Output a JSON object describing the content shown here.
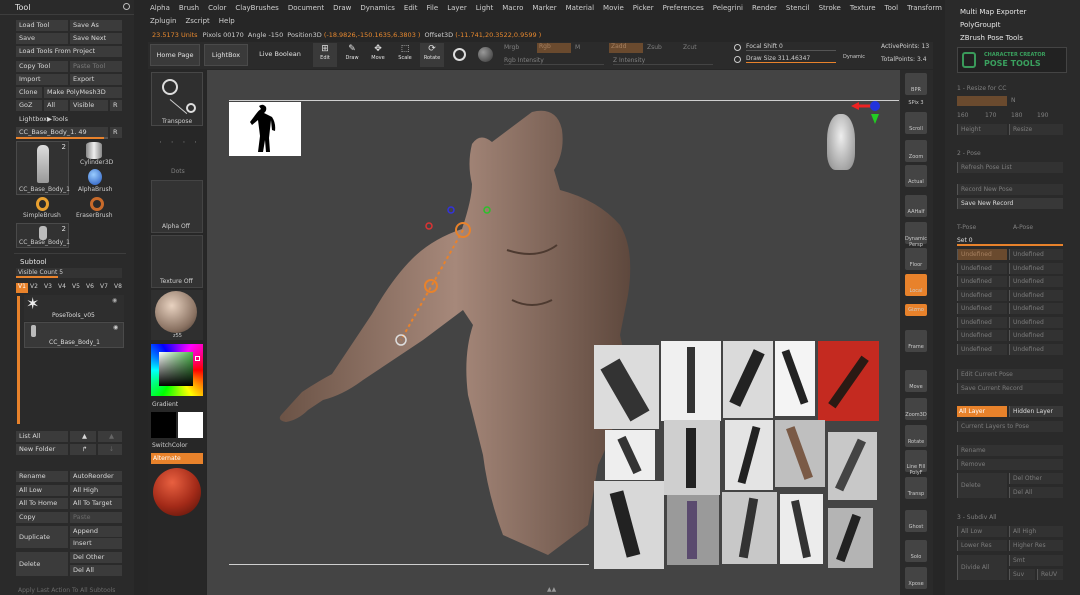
{
  "tool_panel": {
    "title": "Tool",
    "buttons": [
      {
        "label": "Load Tool"
      },
      {
        "label": "Save As"
      },
      {
        "label": "Save"
      },
      {
        "label": "Save Next"
      },
      {
        "label": "Load Tools From Project"
      },
      {
        "label": "Copy Tool"
      },
      {
        "label": "Paste Tool"
      },
      {
        "label": "Import"
      },
      {
        "label": "Export"
      },
      {
        "label": "Clone"
      },
      {
        "label": "Make PolyMesh3D"
      },
      {
        "label": "GoZ"
      },
      {
        "label": "All"
      },
      {
        "label": "Visible"
      },
      {
        "label": "R"
      },
      {
        "label": "Lightbox▶Tools"
      }
    ],
    "current_tool": "CC_Base_Body_1. 49",
    "current_tool_r": "R",
    "thumbs": [
      {
        "label": "CC_Base_Body_1",
        "count": "2"
      },
      {
        "label": "Cylinder3D",
        "count": ""
      },
      {
        "label": "AlphaBrush",
        "count": ""
      },
      {
        "label": "SimpleBrush",
        "count": ""
      },
      {
        "label": "EraserBrush",
        "count": ""
      },
      {
        "label": "CC_Base_Body_1",
        "count": "2"
      }
    ],
    "subtool_title": "Subtool",
    "visible_count": "Visible Count 5",
    "v_tabs": [
      "V1",
      "V2",
      "V3",
      "V4",
      "V5",
      "V6",
      "V7",
      "V8"
    ],
    "subtools": [
      {
        "label": "PoseTools_v05"
      },
      {
        "label": "CC_Base_Body_1"
      }
    ],
    "list_all": "List All",
    "new_folder": "New Folder",
    "bottom_buttons": [
      {
        "label": "Rename"
      },
      {
        "label": "AutoReorder"
      },
      {
        "label": "All Low"
      },
      {
        "label": "All High"
      },
      {
        "label": "All To Home"
      },
      {
        "label": "All To Target"
      },
      {
        "label": "Copy"
      },
      {
        "label": "Paste"
      },
      {
        "label": "Duplicate"
      },
      {
        "label": "Append"
      },
      {
        "label": "Insert"
      },
      {
        "label": "Delete"
      },
      {
        "label": "Del Other"
      },
      {
        "label": "Del All"
      }
    ],
    "footer": "Apply Last Action To All Subtools"
  },
  "menu": [
    "Alpha",
    "Brush",
    "Color",
    "ClayBrushes",
    "Document",
    "Draw",
    "Dynamics",
    "Edit",
    "File",
    "Layer",
    "Light",
    "Macro",
    "Marker",
    "Material",
    "Movie",
    "Picker",
    "Preferences",
    "Pelegrini",
    "Render",
    "Stencil",
    "Stroke",
    "Texture",
    "Tool",
    "Transform"
  ],
  "menu_row2": [
    "Zplugin",
    "Zscript",
    "Help"
  ],
  "status": {
    "units": "23.5173 Units",
    "pixols": "Pixols 00170",
    "angle": "Angle -150",
    "position": "Position3D",
    "position_val": "(-18.9826,-150.1635,6.3803 )",
    "offset": "Offset3D",
    "offset_val": "(-11.741,20.3522,0.9599 )"
  },
  "toolbar": {
    "home_page": "Home Page",
    "lightbox": "LightBox",
    "live_boolean": "Live Boolean",
    "edit": "Edit",
    "draw": "Draw",
    "move": "Move",
    "scale": "Scale",
    "rotate": "Rotate",
    "mrgb": "Mrgb",
    "rgb": "Rgb",
    "m": "M",
    "zadd": "Zadd",
    "zsub": "Zsub",
    "zcut": "Zcut",
    "rgb_intensity": "Rgb Intensity",
    "z_intensity": "Z Intensity",
    "focal_shift": "Focal Shift 0",
    "draw_size": "Draw Size 311.46347",
    "dynamic": "Dynamic",
    "active_points": "ActivePoints: 13",
    "total_points": "TotalPoints: 3.4"
  },
  "left_tray": {
    "transpose": "Transpose",
    "dots": "Dots",
    "alpha_off": "Alpha Off",
    "texture_off": "Texture Off",
    "material": "z55",
    "gradient": "Gradient",
    "switch_color": "SwitchColor",
    "alternate": "Alternate"
  },
  "right_shelf": [
    {
      "label": "BPR",
      "name": "bpr"
    },
    {
      "label": "SPix 3",
      "name": "spix"
    },
    {
      "label": "Scroll",
      "name": "scroll"
    },
    {
      "label": "Zoom",
      "name": "zoom"
    },
    {
      "label": "Actual",
      "name": "actual"
    },
    {
      "label": "AAHalf",
      "name": "aahalf"
    },
    {
      "label": "Dynamic Persp",
      "name": "persp"
    },
    {
      "label": "Floor",
      "name": "floor"
    },
    {
      "label": "Local",
      "name": "local"
    },
    {
      "label": "Gizmo",
      "name": "gizmo"
    },
    {
      "label": "Frame",
      "name": "frame"
    },
    {
      "label": "Move",
      "name": "move"
    },
    {
      "label": "Zoom3D",
      "name": "zoom3d"
    },
    {
      "label": "Rotate",
      "name": "rotate"
    },
    {
      "label": "Line Fill PolyF",
      "name": "polyf"
    },
    {
      "label": "Transp",
      "name": "transp"
    },
    {
      "label": "Ghost",
      "name": "ghost"
    },
    {
      "label": "Solo",
      "name": "solo"
    },
    {
      "label": "Xpose",
      "name": "xpose"
    }
  ],
  "right_panel": {
    "multi_map": "Multi Map Exporter",
    "polygroupit": "PolyGroupIt",
    "pose_tools": "ZBrush Pose Tools",
    "logo_top": "CHARACTER CREATOR",
    "logo_bottom": "POSE TOOLS",
    "s1": "1 - Resize for CC",
    "resize_val": "",
    "n": "N",
    "sizes": [
      "160",
      "170",
      "180",
      "190"
    ],
    "height": "Height",
    "resize": "Resize",
    "s2": "2 - Pose",
    "refresh": "Refresh Pose List",
    "record_new": "Record New Pose",
    "save_new": "Save New Record",
    "tpose": "T-Pose",
    "apose": "A-Pose",
    "set": "Set 0",
    "undefined_rows": [
      [
        "Undefined",
        "Undefined"
      ],
      [
        "Undefined",
        "Undefined"
      ],
      [
        "Undefined",
        "Undefined"
      ],
      [
        "Undefined",
        "Undefined"
      ],
      [
        "Undefined",
        "Undefined"
      ],
      [
        "Undefined",
        "Undefined"
      ],
      [
        "Undefined",
        "Undefined"
      ],
      [
        "Undefined",
        "Undefined"
      ]
    ],
    "edit_pose": "Edit Current Pose",
    "save_pose": "Save Current Record",
    "all_layer": "All Layer",
    "hidden_layer": "Hidden Layer",
    "current_layers": "Current Layers to Pose",
    "rename": "Rename",
    "remove": "Remove",
    "delete": "Delete",
    "del_other": "Del Other",
    "del_all": "Del All",
    "s3": "3 - Subdiv All",
    "all_low": "All Low",
    "all_high": "All High",
    "lower_res": "Lower Res",
    "higher_res": "Higher Res",
    "divide_all": "Divide All",
    "smt": "Smt",
    "suv": "Suv",
    "relu": "ReUV"
  }
}
